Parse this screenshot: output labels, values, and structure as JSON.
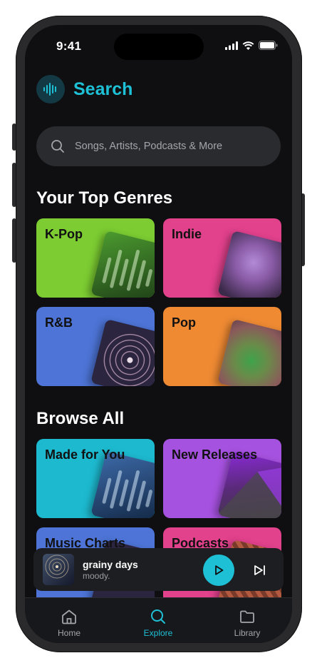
{
  "status_bar": {
    "time": "9:41"
  },
  "header": {
    "title": "Search",
    "logo_icon": "waveform-icon"
  },
  "search": {
    "placeholder": "Songs, Artists, Podcasts & More",
    "value": ""
  },
  "top_genres": {
    "title": "Your Top Genres",
    "items": [
      {
        "label": "K-Pop",
        "color": "#7ccc32"
      },
      {
        "label": "Indie",
        "color": "#e2418c"
      },
      {
        "label": "R&B",
        "color": "#4d74d6"
      },
      {
        "label": "Pop",
        "color": "#ef8a33"
      }
    ]
  },
  "browse_all": {
    "title": "Browse All",
    "items": [
      {
        "label": "Made for You",
        "color": "#1db9cf"
      },
      {
        "label": "New Releases",
        "color": "#a652e0"
      },
      {
        "label": "Music Charts",
        "color": "#4d74d6"
      },
      {
        "label": "Podcasts",
        "color": "#e2418c"
      }
    ]
  },
  "now_playing": {
    "title": "grainy days",
    "artist": "moody."
  },
  "tabs": [
    {
      "label": "Home",
      "icon": "home-icon",
      "active": false
    },
    {
      "label": "Explore",
      "icon": "search-icon",
      "active": true
    },
    {
      "label": "Library",
      "icon": "folder-icon",
      "active": false
    }
  ],
  "colors": {
    "accent": "#1ec0d6",
    "background": "#0f0f11",
    "surface": "#2a2b2e"
  }
}
